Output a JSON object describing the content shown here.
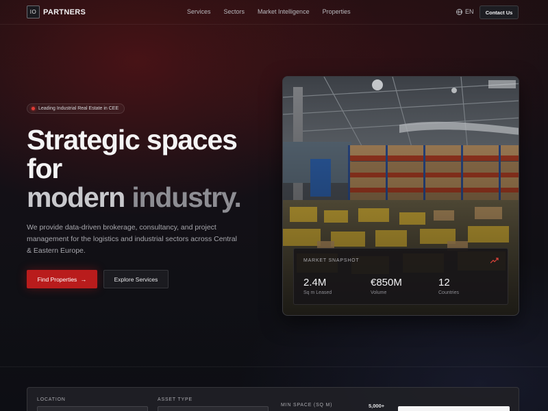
{
  "header": {
    "logo_mark": "IO",
    "logo_text": "PARTNERS",
    "nav": [
      "Services",
      "Sectors",
      "Market Intelligence",
      "Properties"
    ],
    "language": "EN",
    "contact_label": "Contact Us"
  },
  "hero": {
    "badge": "Leading Industrial Real Estate in CEE",
    "title_line1": "Strategic spaces",
    "title_line2": "for",
    "title_line3_a": "modern ",
    "title_line3_b": "industry.",
    "description": "We provide data-driven brokerage, consultancy, and project management for the logistics and industrial sectors across Central & Eastern Europe.",
    "primary_button": "Find Properties",
    "secondary_button": "Explore Services"
  },
  "snapshot": {
    "title": "MARKET SNAPSHOT",
    "stats": [
      {
        "value": "2.4M",
        "label": "Sq m Leased"
      },
      {
        "value": "€850M",
        "label": "Volume"
      },
      {
        "value": "12",
        "label": "Countries"
      }
    ]
  },
  "search": {
    "location_label": "LOCATION",
    "asset_type_label": "ASSET TYPE",
    "min_space_label": "MIN SPACE (SQ M)",
    "min_space_value": "5,000+"
  },
  "colors": {
    "accent": "#b91c1c",
    "badge_dot": "#e03b35"
  },
  "icons": {
    "arrow": "arrow-right-icon",
    "globe": "globe-icon",
    "trend": "trending-up-icon"
  }
}
